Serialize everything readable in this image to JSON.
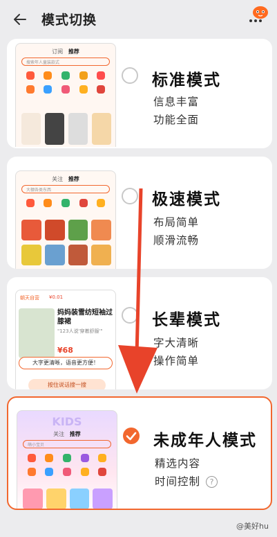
{
  "header": {
    "title": "模式切换",
    "back_icon": "back-arrow-icon",
    "more_icon": "more-mascot-icon"
  },
  "modes": [
    {
      "title": "标准模式",
      "desc": [
        "信息丰富",
        "功能全面"
      ],
      "selected": false
    },
    {
      "title": "极速模式",
      "desc": [
        "布局简单",
        "顺滑流畅"
      ],
      "selected": false
    },
    {
      "title": "长辈模式",
      "desc": [
        "字大清晰",
        "操作简单"
      ],
      "selected": false
    },
    {
      "title": "未成年人模式",
      "desc": [
        "精选内容",
        "时间控制"
      ],
      "selected": true,
      "help_icon": "?"
    }
  ],
  "thumbnails": {
    "standard": {
      "tab_left": "订阅",
      "tab_right": "推荐",
      "search": "搜索年人童装款式"
    },
    "lite": {
      "tab_left": "关注",
      "tab_right": "推荐",
      "search": "大棚各类东西"
    },
    "elder": {
      "product_title": "妈妈装雪纺短袖过膝裙",
      "product_sub": "\"123人说'穿着舒服'\"",
      "price": "¥68",
      "bubble": "大字更清晰，语音更方便！",
      "voice_button": "按住说话搜一搜",
      "tag": "朝天自营",
      "coupon": "¥0.01"
    },
    "minor": {
      "tab_left": "关注",
      "tab_right": "推荐",
      "banner": "KIDS",
      "search": "萌小宝贝"
    }
  },
  "watermark": "@美好hu",
  "colors": {
    "accent": "#f2672e",
    "arrow": "#e8432a",
    "background": "#ececee"
  }
}
